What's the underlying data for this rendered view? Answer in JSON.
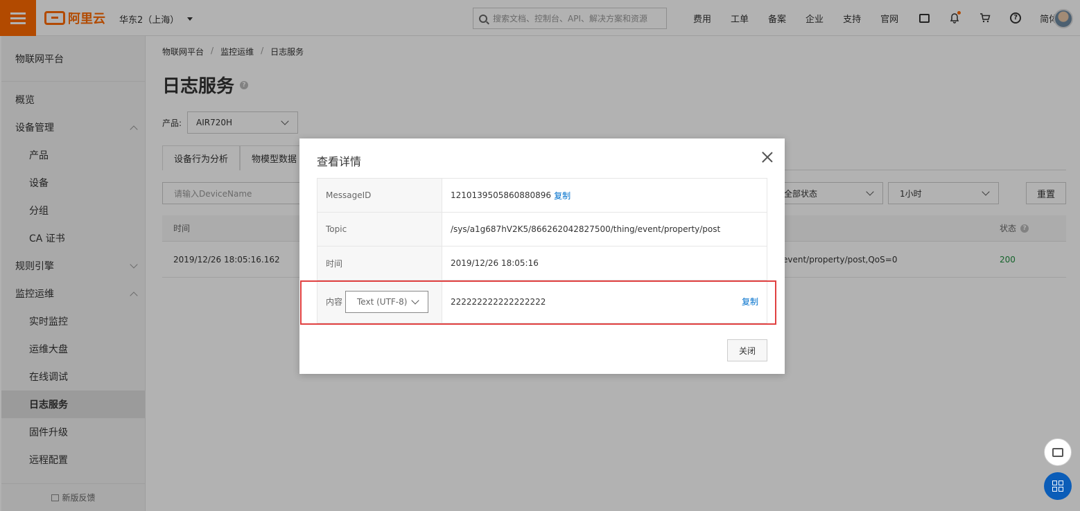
{
  "topbar": {
    "logo_text": "阿里云",
    "region": "华东2（上海）",
    "search_placeholder": "搜索文档、控制台、API、解决方案和资源",
    "links": [
      "费用",
      "工单",
      "备案",
      "企业",
      "支持",
      "官网"
    ],
    "language": "简体",
    "accent_color": "#ff6a00"
  },
  "sidebar": {
    "title": "物联网平台",
    "items": [
      {
        "label": "概览"
      },
      {
        "label": "设备管理"
      },
      {
        "label": "产品"
      },
      {
        "label": "设备"
      },
      {
        "label": "分组"
      },
      {
        "label": "CA 证书"
      },
      {
        "label": "规则引擎"
      },
      {
        "label": "监控运维"
      },
      {
        "label": "实时监控"
      },
      {
        "label": "运维大盘"
      },
      {
        "label": "在线调试"
      },
      {
        "label": "日志服务"
      },
      {
        "label": "固件升级"
      },
      {
        "label": "远程配置"
      }
    ],
    "feedback": "新版反馈"
  },
  "main": {
    "breadcrumb": [
      "物联网平台",
      "监控运维",
      "日志服务"
    ],
    "breadcrumb_sep": "/",
    "title": "日志服务",
    "product_label": "产品:",
    "product_value": "AIR720H",
    "tabs": [
      "设备行为分析",
      "物模型数据"
    ],
    "device_placeholder": "请输入DeviceName",
    "status_select": "全部状态",
    "time_select": "1小时",
    "reset_label": "重置",
    "table": {
      "col_time": "时间",
      "col_status": "状态",
      "row": {
        "time": "2019/12/26 18:05:16.162",
        "content_tail": "event/property/post,QoS=0",
        "status": "200"
      }
    }
  },
  "modal": {
    "title": "查看详情",
    "rows": {
      "message_id_label": "MessageID",
      "message_id_value": "1210139505860880896",
      "copy_label": "复制",
      "topic_label": "Topic",
      "topic_value": "/sys/a1g687hV2K5/866262042827500/thing/event/property/post",
      "time_label": "时间",
      "time_value": "2019/12/26 18:05:16",
      "content_label": "内容",
      "encoding": "Text (UTF-8)",
      "content_value": "222222222222222222",
      "content_copy": "复制"
    },
    "close_label": "关闭",
    "highlight_color": "#e04040"
  }
}
